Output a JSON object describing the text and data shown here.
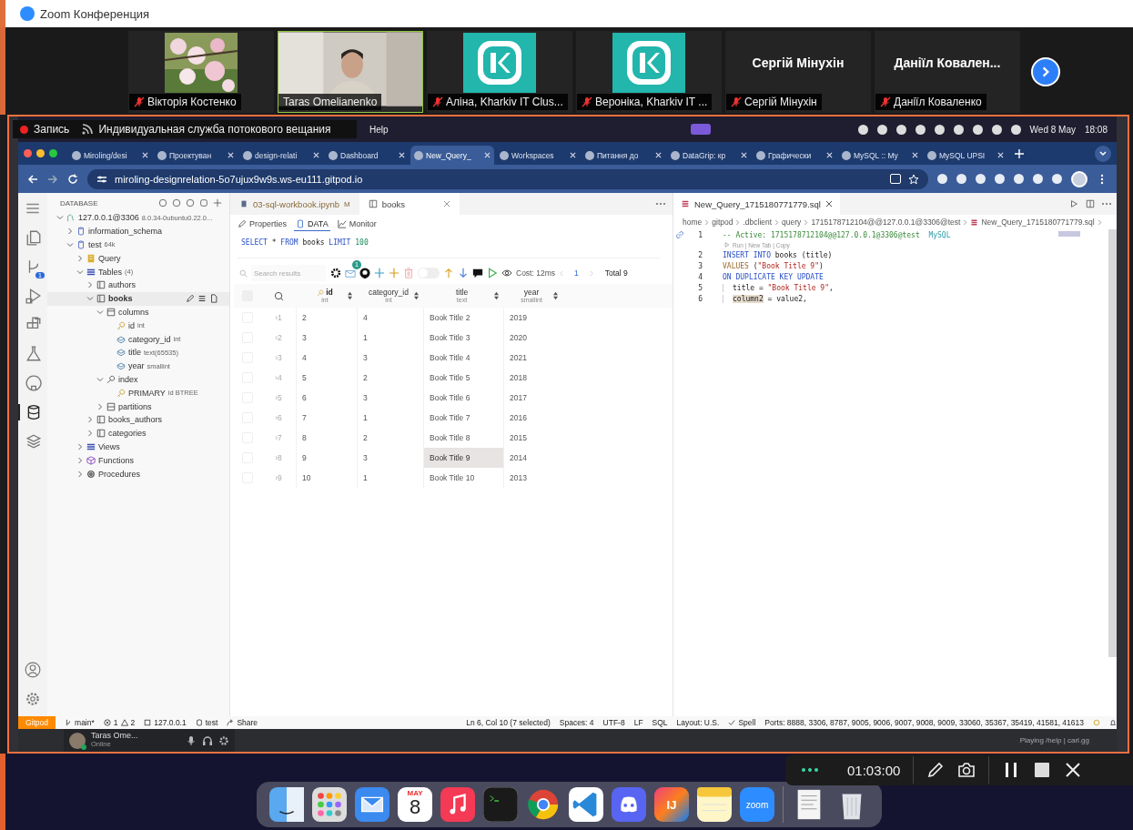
{
  "zoom_window": {
    "title": "Zoom Конференция"
  },
  "participants": [
    {
      "name": "Вікторія Костенко",
      "kind": "picture",
      "muted": true,
      "selected": false
    },
    {
      "name": "Taras Omelianenko",
      "kind": "video",
      "muted": false,
      "selected": true
    },
    {
      "name": "Аліна, Kharkiv IT Clus...",
      "kind": "logo",
      "muted": true,
      "selected": false
    },
    {
      "name": "Вероніка, Kharkiv IT ...",
      "kind": "logo",
      "muted": true,
      "selected": false
    },
    {
      "name": "Сергій Мінухін",
      "kind": "name",
      "display": "Сергій Мінухін",
      "muted": true,
      "selected": false
    },
    {
      "name": "Даніїл Коваленко",
      "kind": "name",
      "display": "Даніїл Ковален...",
      "muted": true,
      "selected": false
    }
  ],
  "recording_overlay": {
    "label": "Запись",
    "service": "Индивидуальная служба потокового вещания"
  },
  "mac_menubar": {
    "menus": [
      "Help"
    ],
    "date": "Wed 8 May",
    "time": "18:08"
  },
  "browser": {
    "tabs": [
      {
        "label": "Miroling/desi",
        "selected": false
      },
      {
        "label": "Проектуван",
        "selected": false
      },
      {
        "label": "design-relati",
        "selected": false
      },
      {
        "label": "Dashboard",
        "selected": false
      },
      {
        "label": "New_Query_",
        "selected": true
      },
      {
        "label": "Workspaces",
        "selected": false
      },
      {
        "label": "Питання до",
        "selected": false
      },
      {
        "label": "DataGrip: кр",
        "selected": false
      },
      {
        "label": "Графически",
        "selected": false
      },
      {
        "label": "MySQL :: My",
        "selected": false
      },
      {
        "label": "MySQL UPSI",
        "selected": false
      }
    ],
    "url": "miroling-designrelation-5o7ujux9w9s.ws-eu111.gitpod.io"
  },
  "activity_bar": [
    {
      "kind": "explorer",
      "selected": false
    },
    {
      "kind": "source-control",
      "selected": false,
      "badge": "1"
    },
    {
      "kind": "run",
      "selected": false
    },
    {
      "kind": "extensions",
      "selected": false
    },
    {
      "kind": "testing",
      "selected": false
    },
    {
      "kind": "github",
      "selected": false
    },
    {
      "kind": "database",
      "selected": true
    },
    {
      "kind": "layers",
      "selected": false
    }
  ],
  "sidebar": {
    "title": "DATABASE",
    "tree": [
      {
        "label": "127.0.0.1@3306",
        "detail": "8.0.34-0ubuntu0.22.0...",
        "kind": "server",
        "expanded": true,
        "children": [
          {
            "label": "information_schema",
            "kind": "database",
            "expanded": false
          },
          {
            "label": "test",
            "detail": "64k",
            "kind": "database",
            "expanded": true,
            "children": [
              {
                "label": "Query",
                "kind": "query",
                "expanded": false
              },
              {
                "label": "Tables",
                "detail": "(4)",
                "kind": "tables",
                "expanded": true,
                "children": [
                  {
                    "label": "authors",
                    "kind": "table",
                    "expanded": false
                  },
                  {
                    "label": "books",
                    "kind": "table",
                    "expanded": true,
                    "children": [
                      {
                        "label": "columns",
                        "kind": "columns",
                        "expanded": true,
                        "children": [
                          {
                            "label": "id",
                            "detail": "int",
                            "kind": "key-column"
                          },
                          {
                            "label": "category_id",
                            "detail": "int",
                            "kind": "column"
                          },
                          {
                            "label": "title",
                            "detail": "text(65535)",
                            "kind": "column"
                          },
                          {
                            "label": "year",
                            "detail": "smallint",
                            "kind": "column"
                          }
                        ]
                      },
                      {
                        "label": "index",
                        "kind": "index",
                        "expanded": true,
                        "children": [
                          {
                            "label": "PRIMARY",
                            "detail": "id BTREE",
                            "kind": "key-column"
                          }
                        ]
                      },
                      {
                        "label": "partitions",
                        "kind": "partitions",
                        "expanded": false
                      }
                    ]
                  },
                  {
                    "label": "books_authors",
                    "kind": "table",
                    "expanded": false
                  },
                  {
                    "label": "categories",
                    "kind": "table",
                    "expanded": false
                  }
                ]
              },
              {
                "label": "Views",
                "kind": "tables",
                "expanded": false
              },
              {
                "label": "Functions",
                "kind": "functions",
                "expanded": false
              },
              {
                "label": "Procedures",
                "kind": "procedures",
                "expanded": false
              }
            ]
          }
        ]
      }
    ]
  },
  "data_panel": {
    "tabs": [
      {
        "label": "03-sql-workbook.ipynb",
        "badge": "M",
        "kind": "notebook",
        "selected": false
      },
      {
        "label": "books",
        "kind": "table",
        "selected": true
      }
    ],
    "views": [
      {
        "label": "Properties",
        "kind": "properties",
        "selected": false
      },
      {
        "label": "DATA",
        "kind": "data",
        "selected": true
      },
      {
        "label": "Monitor",
        "kind": "monitor",
        "selected": false
      }
    ],
    "query": [
      {
        "text": "SELECT",
        "kind": "keyword"
      },
      {
        "text": " * ",
        "kind": "plain"
      },
      {
        "text": "FROM",
        "kind": "keyword"
      },
      {
        "text": " books ",
        "kind": "plain"
      },
      {
        "text": "LIMIT",
        "kind": "keyword"
      },
      {
        "text": " 100",
        "kind": "number"
      }
    ],
    "search": {
      "placeholder": "Search results"
    },
    "notification_badge": "1",
    "toggle": {
      "on": false
    },
    "all_checked": false,
    "cost": "Cost: 12ms",
    "page": "1",
    "total": "Total 9",
    "columns": [
      {
        "name": "id",
        "type": "int",
        "key": true
      },
      {
        "name": "category_id",
        "type": "int",
        "key": false
      },
      {
        "name": "title",
        "type": "text",
        "key": false
      },
      {
        "name": "year",
        "type": "smallint",
        "key": false
      }
    ],
    "rows": [
      {
        "num": "›1",
        "checked": false,
        "cells": [
          {
            "text": "2",
            "selected": false
          },
          {
            "text": "4",
            "selected": false
          },
          {
            "text": "Book Title 2",
            "selected": false
          },
          {
            "text": "2019",
            "selected": false
          }
        ]
      },
      {
        "num": "›2",
        "checked": false,
        "cells": [
          {
            "text": "3",
            "selected": false
          },
          {
            "text": "1",
            "selected": false
          },
          {
            "text": "Book Title 3",
            "selected": false
          },
          {
            "text": "2020",
            "selected": false
          }
        ]
      },
      {
        "num": "›3",
        "checked": false,
        "cells": [
          {
            "text": "4",
            "selected": false
          },
          {
            "text": "3",
            "selected": false
          },
          {
            "text": "Book Title 4",
            "selected": false
          },
          {
            "text": "2021",
            "selected": false
          }
        ]
      },
      {
        "num": "›4",
        "checked": false,
        "cells": [
          {
            "text": "5",
            "selected": false
          },
          {
            "text": "2",
            "selected": false
          },
          {
            "text": "Book Title 5",
            "selected": false
          },
          {
            "text": "2018",
            "selected": false
          }
        ]
      },
      {
        "num": "›5",
        "checked": false,
        "cells": [
          {
            "text": "6",
            "selected": false
          },
          {
            "text": "3",
            "selected": false
          },
          {
            "text": "Book Title 6",
            "selected": false
          },
          {
            "text": "2017",
            "selected": false
          }
        ]
      },
      {
        "num": "›6",
        "checked": false,
        "cells": [
          {
            "text": "7",
            "selected": false
          },
          {
            "text": "1",
            "selected": false
          },
          {
            "text": "Book Title 7",
            "selected": false
          },
          {
            "text": "2016",
            "selected": false
          }
        ]
      },
      {
        "num": "›7",
        "checked": false,
        "cells": [
          {
            "text": "8",
            "selected": false
          },
          {
            "text": "2",
            "selected": false
          },
          {
            "text": "Book Title 8",
            "selected": false
          },
          {
            "text": "2015",
            "selected": false
          }
        ]
      },
      {
        "num": "›8",
        "checked": false,
        "cells": [
          {
            "text": "9",
            "selected": false
          },
          {
            "text": "3",
            "selected": false
          },
          {
            "text": "Book Title 9",
            "selected": true
          },
          {
            "text": "2014",
            "selected": false
          }
        ]
      },
      {
        "num": "›9",
        "checked": false,
        "cells": [
          {
            "text": "10",
            "selected": false
          },
          {
            "text": "1",
            "selected": false
          },
          {
            "text": "Book Title 10",
            "selected": false
          },
          {
            "text": "2013",
            "selected": false
          }
        ]
      }
    ]
  },
  "editor": {
    "tab": "New_Query_1715180771779.sql",
    "breadcrumbs": [
      "home",
      "gitpod",
      ".dbclient",
      "query",
      "1715178712104@@127.0.0.1@3306@test",
      "New_Query_1715180771779.sql"
    ],
    "codelens": "Run | New Tab | Copy",
    "lines": [
      {
        "num": "1",
        "tokens": [
          {
            "text": "-- Active: 1715178712104@@127.0.0.1@3306@test  ",
            "kind": "comment"
          },
          {
            "text": "MySQL",
            "kind": "type"
          }
        ]
      },
      {
        "num": "2",
        "tokens": [
          {
            "text": "INSERT INTO",
            "kind": "keyword"
          },
          {
            "text": " books (title)",
            "kind": "plain"
          }
        ]
      },
      {
        "num": "3",
        "tokens": [
          {
            "text": "VALUES",
            "kind": "function"
          },
          {
            "text": " (",
            "kind": "plain"
          },
          {
            "text": "\"Book Title 9\"",
            "kind": "string"
          },
          {
            "text": ")",
            "kind": "plain"
          }
        ]
      },
      {
        "num": "4",
        "tokens": [
          {
            "text": "ON DUPLICATE KEY UPDATE",
            "kind": "keyword"
          }
        ]
      },
      {
        "num": "5",
        "tokens": [
          {
            "text": "title = ",
            "kind": "plain"
          },
          {
            "text": "\"Book Title 9\"",
            "kind": "string"
          },
          {
            "text": ",",
            "kind": "plain"
          }
        ]
      },
      {
        "num": "6",
        "tokens": [
          {
            "text": "column2",
            "kind": "selection"
          },
          {
            "text": " = value2,",
            "kind": "plain"
          }
        ]
      }
    ]
  },
  "status_bar": {
    "left": [
      {
        "kind": "gitpod",
        "text": "Gitpod"
      },
      {
        "kind": "branch",
        "text": "main*"
      },
      {
        "kind": "problems",
        "errors": "1",
        "warnings": "2"
      },
      {
        "kind": "server",
        "text": "127.0.0.1"
      },
      {
        "kind": "database",
        "text": "test"
      },
      {
        "kind": "share",
        "text": "Share"
      }
    ],
    "right": [
      {
        "kind": "text",
        "text": "Ln 6, Col 10 (7 selected)"
      },
      {
        "kind": "text",
        "text": "Spaces: 4"
      },
      {
        "kind": "text",
        "text": "UTF-8"
      },
      {
        "kind": "text",
        "text": "LF"
      },
      {
        "kind": "text",
        "text": "SQL"
      },
      {
        "kind": "text",
        "text": "Layout: U.S."
      },
      {
        "kind": "check",
        "text": "Spell"
      },
      {
        "kind": "text",
        "text": "Ports: 8888, 3306, 8787, 9005, 9006, 9007, 9008, 9009, 33060, 35367, 35419, 41581, 41613"
      }
    ]
  },
  "discord": {
    "user": "Taras Ome...",
    "status": "Online",
    "activity": "Playing /help | carl.gg"
  },
  "dock": [
    {
      "kind": "finder"
    },
    {
      "kind": "launchpad"
    },
    {
      "kind": "mail"
    },
    {
      "kind": "calendar",
      "month": "MAY",
      "day": "8"
    },
    {
      "kind": "music"
    },
    {
      "kind": "terminal"
    },
    {
      "kind": "chrome"
    },
    {
      "kind": "vscode"
    },
    {
      "kind": "discord"
    },
    {
      "kind": "intellij",
      "label": "IJ"
    },
    {
      "kind": "notes"
    },
    {
      "kind": "zoom",
      "label": "zoom"
    },
    {
      "kind": "document"
    },
    {
      "kind": "trash"
    }
  ],
  "recorder": {
    "time": "01:03:00"
  }
}
